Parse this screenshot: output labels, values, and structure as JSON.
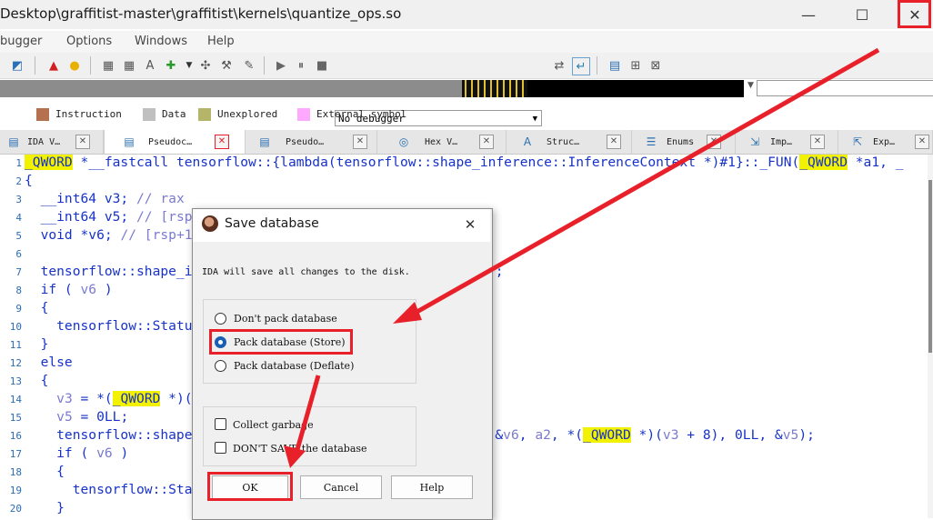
{
  "window": {
    "title": "Desktop\\graffitist-master\\graffitist\\kernels\\quantize_ops.so",
    "minimize": "—",
    "maximize": "☐",
    "close": "✕"
  },
  "menu": [
    "bugger",
    "Options",
    "Windows",
    "Help"
  ],
  "toolbar": {
    "debugger_select": "No debugger",
    "icons": [
      "save-icon",
      "warning-icon",
      "lightbulb-icon",
      "hex-icon",
      "struct-icon",
      "add-icon",
      "run-icon",
      "dropdown-icon",
      "cross-icon",
      "tool-icon",
      "close-x-icon",
      "play-icon",
      "pause-icon",
      "stop-icon",
      "debug1-icon",
      "debug2-icon",
      "list-icon",
      "tree-icon",
      "delete-icon"
    ]
  },
  "legend": [
    {
      "label": "Instruction",
      "color": "#b5714f"
    },
    {
      "label": "Data",
      "color": "#c0c0c0"
    },
    {
      "label": "Unexplored",
      "color": "#b5b56a"
    },
    {
      "label": "External symbol",
      "color": "#ffa8ff"
    }
  ],
  "tabs": [
    {
      "label": "IDA V…",
      "icon": "ida-icon",
      "active": false
    },
    {
      "label": "Pseudoc…",
      "icon": "pseudocode-icon",
      "active": true
    },
    {
      "label": "Pseudo…",
      "icon": "pseudocode-icon",
      "active": false
    },
    {
      "label": "Hex V…",
      "icon": "hex-view-icon",
      "active": false
    },
    {
      "label": "Struc…",
      "icon": "structures-icon",
      "active": false
    },
    {
      "label": "Enums",
      "icon": "enums-icon",
      "active": false
    },
    {
      "label": "Imp…",
      "icon": "imports-icon",
      "active": false
    },
    {
      "label": "Exp…",
      "icon": "exports-icon",
      "active": false
    }
  ],
  "code": {
    "line_numbers": [
      "1",
      "2",
      "3",
      "4",
      "5",
      "6",
      "7",
      "8",
      "9",
      "10",
      "11",
      "12",
      "13",
      "14",
      "15",
      "16",
      "17",
      "18",
      "19",
      "20"
    ],
    "l1a": "_QWORD",
    "l1b": " *__fastcall tensorflow::{lambda(tensorflow::shape_inference::InferenceContext *)#1}::_FUN(",
    "l1c": "_QWORD",
    "l1d": " *a1, _",
    "l2": "{",
    "l3a": "  __int64 v3; ",
    "l3b": "// rax",
    "l4a": "  __int64 v5; ",
    "l4b": "// [rsp",
    "l5a": "  void *v6; ",
    "l5b": "// [rsp+1",
    "l7a": "  tensorflow::shape_i",
    "l7b": ");",
    "l8a": "  if ( ",
    "l8b": "v6",
    "l8c": " )",
    "l9": "  {",
    "l10": "    tensorflow::Statu",
    "l11": "  }",
    "l12": "  else",
    "l13": "  {",
    "l14a": "    ",
    "l14b": "v3",
    "l14c": " = *(",
    "l14d": "_QWORD",
    "l14e": " *)(",
    "l15a": "    ",
    "l15b": "v5",
    "l15c": " = 0LL;",
    "l16a": "    tensorflow::shape",
    "l16b": "nk(&",
    "l16c": "v6",
    "l16d": ", ",
    "l16e": "a2",
    "l16f": ", *(",
    "l16g": "_QWORD",
    "l16h": " *)(",
    "l16i": "v3",
    "l16j": " + 8), 0LL, &",
    "l16k": "v5",
    "l16l": ");",
    "l17a": "    if ( ",
    "l17b": "v6",
    "l17c": " )",
    "l18": "    {",
    "l19": "      tensorflow::Sta",
    "l20": "    }"
  },
  "dialog": {
    "title": "Save database",
    "message": "IDA will save all changes to the disk.",
    "options": [
      {
        "label": "Don't pack database",
        "selected": false
      },
      {
        "label": "Pack database (Store)",
        "selected": true
      },
      {
        "label": "Pack database (Deflate)",
        "selected": false
      }
    ],
    "checkboxes": [
      {
        "label": "Collect garbage",
        "checked": false
      },
      {
        "label": "DON'T SAVE the database",
        "checked": false
      }
    ],
    "ok": "OK",
    "cancel": "Cancel",
    "help": "Help",
    "close": "✕"
  },
  "annotation_color": "#e8202a"
}
